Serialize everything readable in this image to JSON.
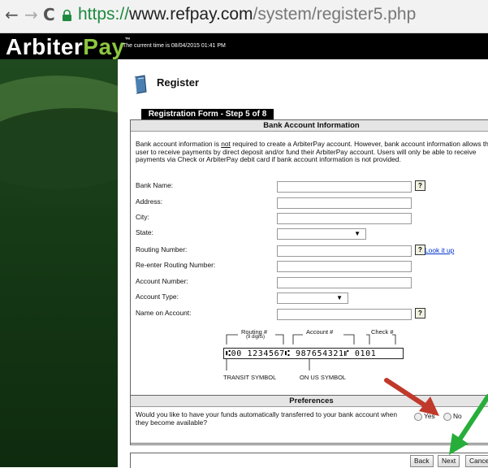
{
  "browser": {
    "url_scheme": "https://",
    "url_host": "www.refpay.com",
    "url_path": "/system/register5.php"
  },
  "header": {
    "logo_part1": "Arbiter",
    "logo_part2": "Pay",
    "logo_tm": "™",
    "current_time": "The current time is 08/04/2015 01:41 PM"
  },
  "page": {
    "title": "Register",
    "step_tab": "Registration Form - Step 5 of 8",
    "section_title": "Bank Account Information",
    "intro_a": "Bank account information is ",
    "intro_not": "not",
    "intro_b": " required to create a ArbiterPay account. However, bank account information allows the user to receive payments by direct deposit and/or fund their ArbiterPay account. Users will only be able to receive payments via Check or ArbiterPay debit card if bank account information is not provided."
  },
  "form": {
    "bank_name": {
      "label": "Bank Name:",
      "value": ""
    },
    "address": {
      "label": "Address:",
      "value": ""
    },
    "city": {
      "label": "City:",
      "value": ""
    },
    "state": {
      "label": "State:",
      "value": ""
    },
    "routing": {
      "label": "Routing Number:",
      "value": "",
      "lookup": "Look it up"
    },
    "routing_confirm": {
      "label": "Re-enter Routing Number:",
      "value": ""
    },
    "account_number": {
      "label": "Account Number:",
      "value": ""
    },
    "account_type": {
      "label": "Account Type:",
      "value": ""
    },
    "name_on_account": {
      "label": "Name on Account:",
      "value": ""
    },
    "help_glyph": "?"
  },
  "check_image": {
    "routing_label": "Routing #",
    "routing_sub": "(9 digits)",
    "account_label": "Account #",
    "check_label": "Check #",
    "micr_line": "⑆00 1234567⑆  987654321⑈  0101",
    "transit_symbol": "TRANSIT SYMBOL",
    "on_us_symbol": "ON US SYMBOL"
  },
  "preferences": {
    "title": "Preferences",
    "question": "Would you like to have your funds automatically transferred to your bank account when they become available?",
    "yes_label": "Yes",
    "no_label": "No"
  },
  "buttons": {
    "back": "Back",
    "next": "Next",
    "cancel": "Cance"
  },
  "colors": {
    "brand_green": "#8cc63f",
    "arrow_red": "#c0392b",
    "arrow_green": "#27ae3a"
  }
}
